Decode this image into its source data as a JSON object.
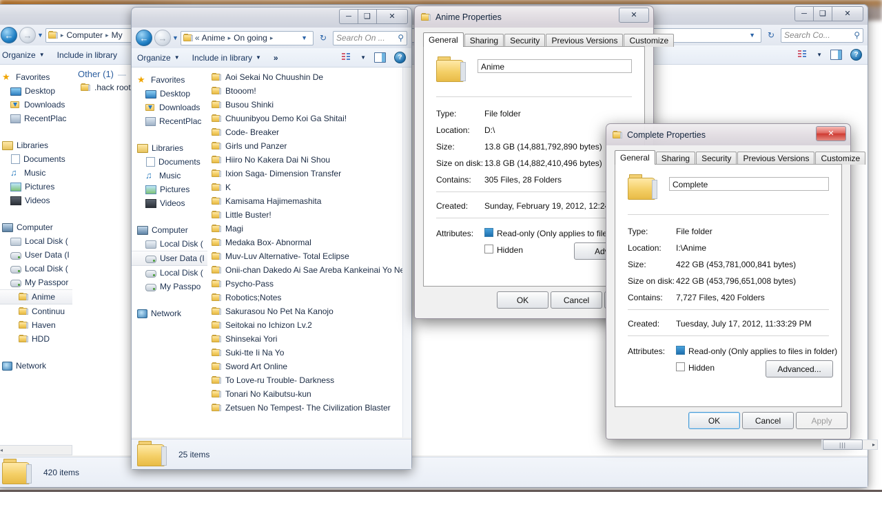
{
  "windows": {
    "background_explorer": {
      "title_visible": "",
      "breadcrumb": [
        "Computer",
        "My"
      ],
      "toolbar": {
        "organize": "Organize",
        "include": "Include in library"
      },
      "search_placeholder": "Search Co...",
      "nav": {
        "favorites_label": "Favorites",
        "favorites": [
          "Desktop",
          "Downloads",
          "RecentPlac"
        ],
        "libraries_label": "Libraries",
        "libraries": [
          "Documents",
          "Music",
          "Pictures",
          "Videos"
        ],
        "computer_label": "Computer",
        "drives": [
          "Local Disk (",
          "User Data (I",
          "Local Disk (",
          "My Passpor"
        ],
        "passport_children": [
          "Anime",
          "Continuu",
          "Haven",
          "HDD"
        ],
        "selected_child": "Anime",
        "network_label": "Network"
      },
      "content": {
        "group_header": "Other (1)",
        "items": [
          ".hack roots"
        ]
      },
      "status": "420 items"
    },
    "ongoing_explorer": {
      "breadcrumb": [
        "Anime",
        "On going"
      ],
      "breadcrumb_prefix": "«",
      "toolbar": {
        "organize": "Organize",
        "include": "Include in library",
        "more": "»"
      },
      "search_placeholder": "Search On ...",
      "nav": {
        "favorites_label": "Favorites",
        "favorites": [
          "Desktop",
          "Downloads",
          "RecentPlac"
        ],
        "libraries_label": "Libraries",
        "libraries": [
          "Documents",
          "Music",
          "Pictures",
          "Videos"
        ],
        "computer_label": "Computer",
        "drives": [
          "Local Disk (",
          "User Data (I",
          "Local Disk (",
          "My Passpo"
        ],
        "selected_drive": "User Data (I",
        "network_label": "Network"
      },
      "folders": [
        "Aoi Sekai No Chuushin De",
        "Btooom!",
        "Busou Shinki",
        "Chuunibyou Demo Koi Ga Shitai!",
        "Code- Breaker",
        "Girls und Panzer",
        "Hiiro No Kakera Dai Ni Shou",
        "Ixion Saga- Dimension Transfer",
        "K",
        "Kamisama Hajimemashita",
        "Little Buster!",
        "Magi",
        "Medaka Box- Abnormal",
        "Muv-Luv Alternative- Total Eclipse",
        "Onii-chan Dakedo Ai Sae Areba Kankeinai Yo Ne",
        "Psycho-Pass",
        "Robotics;Notes",
        "Sakurasou No Pet Na Kanojo",
        "Seitokai no Ichizon Lv.2",
        "Shinsekai Yori",
        "Suki-tte Ii Na Yo",
        "Sword Art Online",
        "To Love-ru Trouble- Darkness",
        "Tonari No Kaibutsu-kun",
        "Zetsuen No Tempest- The Civilization Blaster"
      ],
      "status": "25 items"
    }
  },
  "dialogs": {
    "anime_properties": {
      "title": "Anime Properties",
      "tabs": [
        "General",
        "Sharing",
        "Security",
        "Previous Versions",
        "Customize"
      ],
      "active_tab": "General",
      "name_value": "Anime",
      "fields": [
        {
          "label": "Type:",
          "value": "File folder"
        },
        {
          "label": "Location:",
          "value": "D:\\"
        },
        {
          "label": "Size:",
          "value": "13.8 GB (14,881,792,890 bytes)"
        },
        {
          "label": "Size on disk:",
          "value": "13.8 GB (14,882,410,496 bytes)"
        },
        {
          "label": "Contains:",
          "value": "305 Files, 28 Folders"
        }
      ],
      "created_label": "Created:",
      "created_value": "Sunday, February 19, 2012, 12:24:47 AM",
      "attributes_label": "Attributes:",
      "readonly_label": "Read-only (Only applies to files in folde",
      "hidden_label": "Hidden",
      "advanced_label": "Advan",
      "buttons": {
        "ok": "OK",
        "cancel": "Cancel"
      }
    },
    "complete_properties": {
      "title": "Complete Properties",
      "tabs": [
        "General",
        "Sharing",
        "Security",
        "Previous Versions",
        "Customize"
      ],
      "active_tab": "General",
      "name_value": "Complete",
      "fields": [
        {
          "label": "Type:",
          "value": "File folder"
        },
        {
          "label": "Location:",
          "value": "I:\\Anime"
        },
        {
          "label": "Size:",
          "value": "422 GB (453,781,000,841 bytes)"
        },
        {
          "label": "Size on disk:",
          "value": "422 GB (453,796,651,008 bytes)"
        },
        {
          "label": "Contains:",
          "value": "7,727 Files, 420 Folders"
        }
      ],
      "created_label": "Created:",
      "created_value": "Tuesday, July 17, 2012, 11:33:29 PM",
      "attributes_label": "Attributes:",
      "readonly_label": "Read-only (Only applies to files in folder)",
      "hidden_label": "Hidden",
      "advanced_label": "Advanced...",
      "buttons": {
        "ok": "OK",
        "cancel": "Cancel",
        "apply": "Apply"
      }
    }
  },
  "icons": {
    "minimize": "─",
    "maximize": "❑",
    "close": "✕",
    "back_arrow": "←",
    "forward_arrow": "→",
    "dropdown": "▼",
    "refresh": "↻",
    "search": "⚲",
    "chevron_right": "▸",
    "help": "?",
    "scroll_left": "◂",
    "scroll_right": "▸",
    "grip": "|||"
  },
  "colors": {
    "accent": "#1e6fae",
    "close_red": "#cf3b32",
    "folder_yellow": "#f4cf66",
    "window_border": "#9aa4b4"
  }
}
